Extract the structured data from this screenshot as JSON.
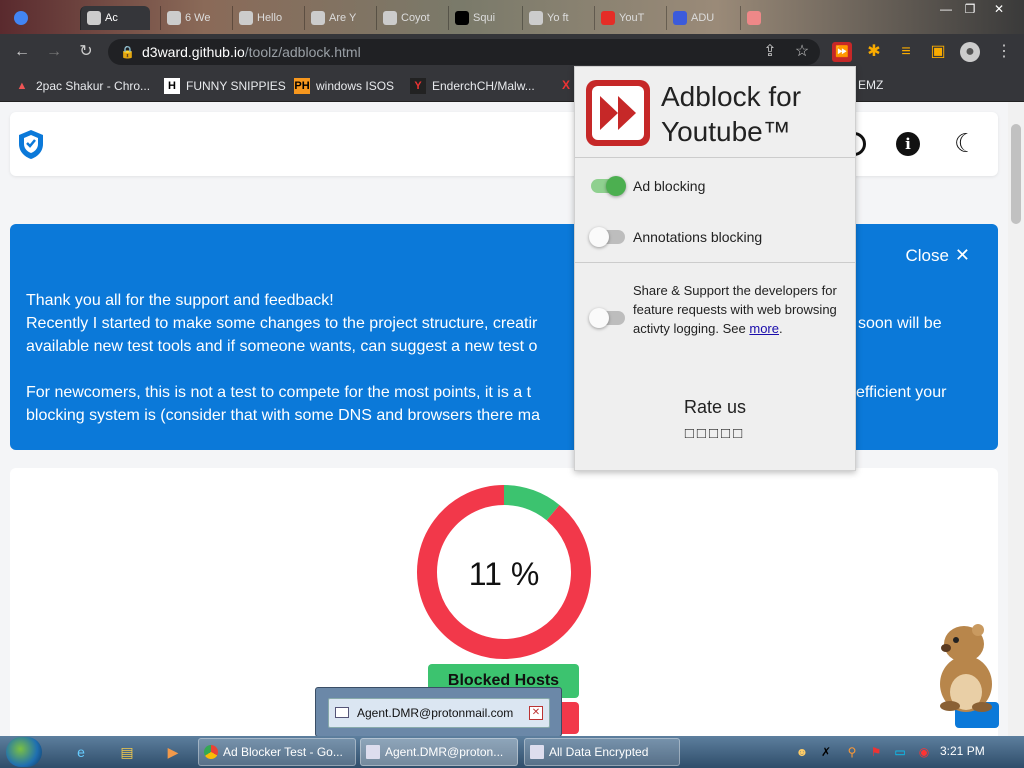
{
  "browser": {
    "tabs": [
      {
        "label": "Ac"
      },
      {
        "label": "6 We"
      },
      {
        "label": "Hello"
      },
      {
        "label": "Are Y"
      },
      {
        "label": "Coyot"
      },
      {
        "label": "Squi"
      },
      {
        "label": "Yo ft"
      },
      {
        "label": "YouT"
      },
      {
        "label": "ADU"
      }
    ],
    "url_host": "d3ward.github.io",
    "url_path": "/toolz/adblock.html",
    "bookmarks": [
      {
        "label": "2pac Shakur - Chro..."
      },
      {
        "label": "FUNNY SNIPPIES"
      },
      {
        "label": "windows ISOS"
      },
      {
        "label": "EnderchCH/Malw..."
      },
      {
        "label": "EMZ"
      }
    ]
  },
  "page": {
    "banner": {
      "close_label": "Close",
      "line1": "Thank you all for the support and feedback!",
      "line2": "Recently I started to make some changes to the project structure, creatir",
      "line2b": "soon will be",
      "line3": "available new test tools and if someone wants, can suggest a new test o",
      "line4": "For newcomers, this is not a test to compete for the most points, it is a t",
      "line4b": "efficient your",
      "line5": "blocking system is (consider that with some DNS and browsers there ma"
    },
    "score_text": "11 %",
    "blocked_hosts_label": "Blocked Hosts"
  },
  "chart_data": {
    "type": "pie",
    "categories": [
      "blocked",
      "not blocked"
    ],
    "values": [
      11,
      89
    ],
    "colors": [
      "#3cc36f",
      "#f2384a"
    ],
    "title": "11 %"
  },
  "popup": {
    "title": "Adblock for Youtube™",
    "options": [
      {
        "label": "Ad blocking",
        "enabled": true
      },
      {
        "label": "Annotations blocking",
        "enabled": false
      }
    ],
    "share_text": "Share & Support the developers for feature requests with web browsing activty logging. See",
    "share_link": "more",
    "share_tail": ".",
    "share_enabled": false,
    "rate_label": "Rate us",
    "stars": "□□□□□"
  },
  "email_popup": {
    "label": "Agent.DMR@protonmail.com"
  },
  "taskbar": {
    "tasks": [
      {
        "label": "Ad Blocker Test - Go..."
      },
      {
        "label": "Agent.DMR@proton..."
      },
      {
        "label": "All Data Encrypted"
      }
    ],
    "clock": "3:21 PM"
  }
}
